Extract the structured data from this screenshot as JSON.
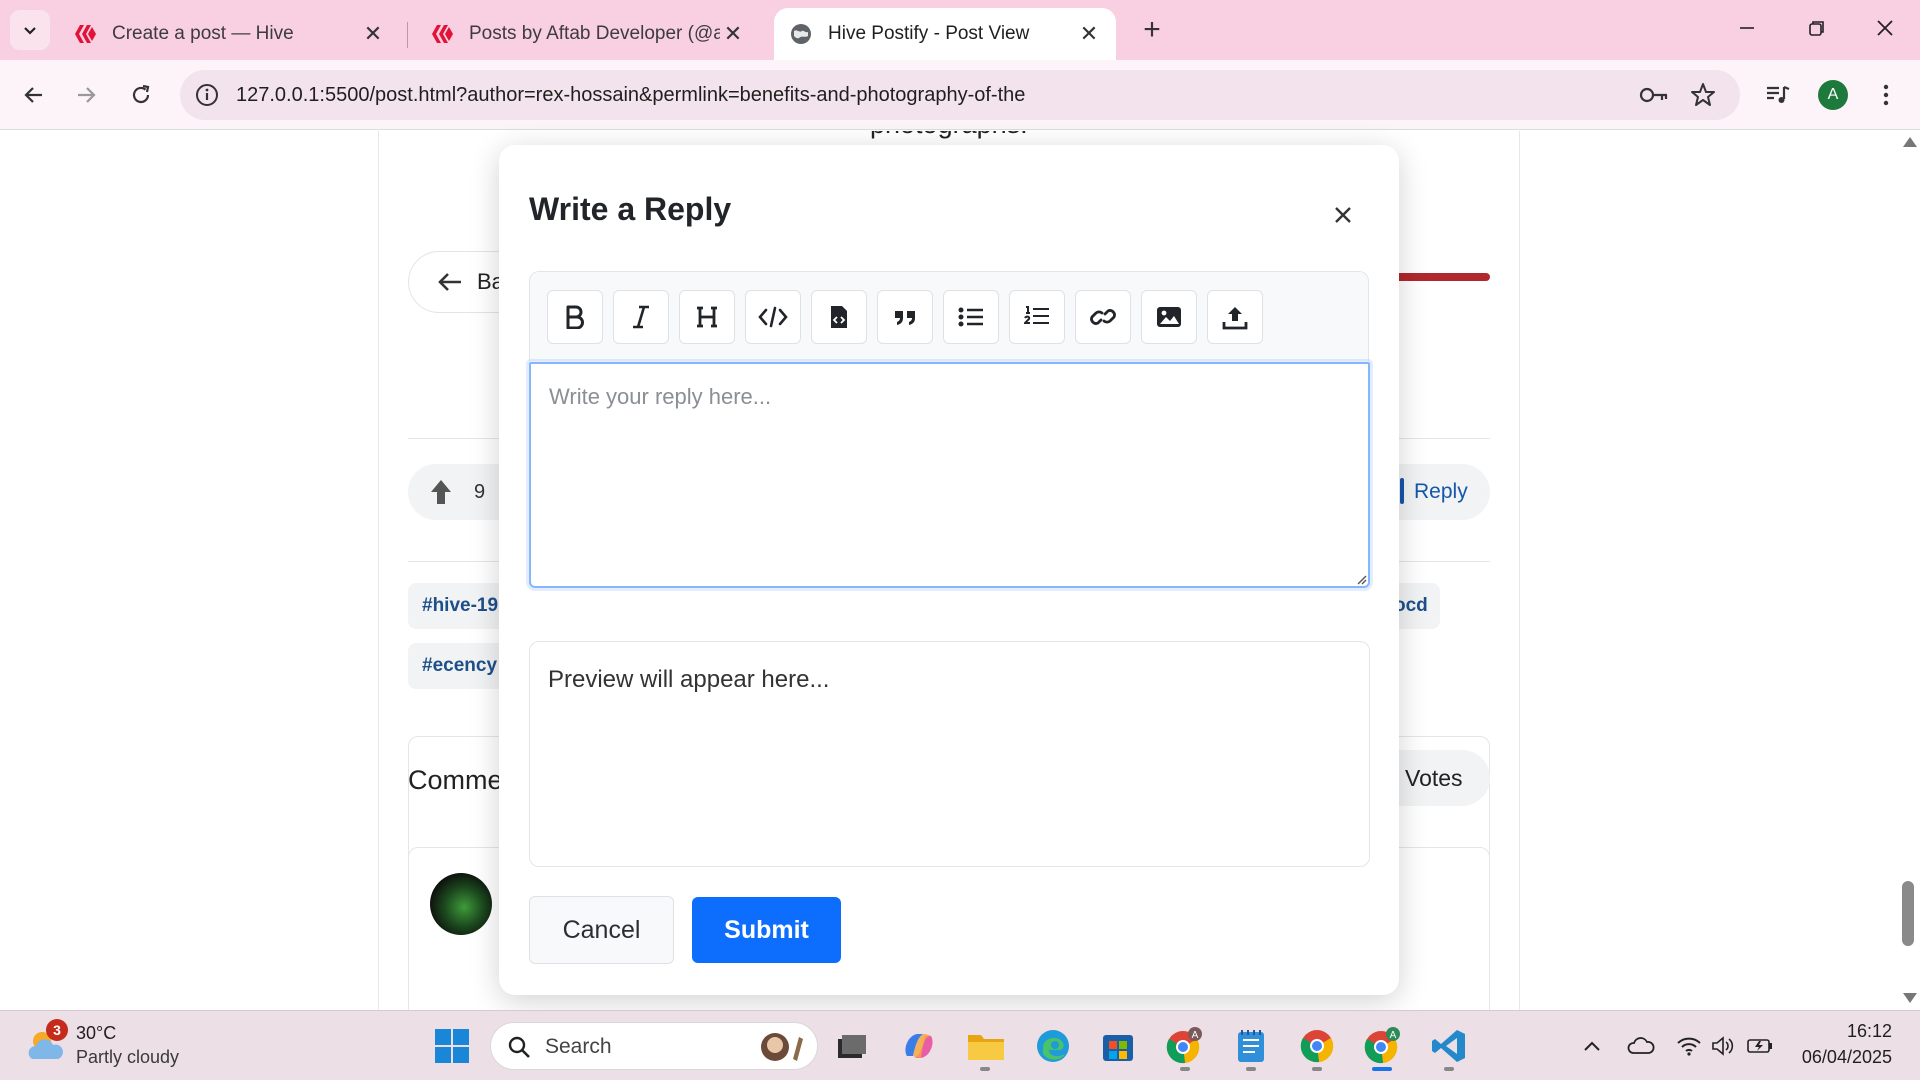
{
  "browser": {
    "tabs": [
      {
        "title": "Create a post — Hive",
        "favicon": "hive-logo-icon",
        "active": false
      },
      {
        "title": "Posts by Aftab Developer (@aftab",
        "favicon": "hive-logo-icon",
        "active": false
      },
      {
        "title": "Hive Postify - Post View",
        "favicon": "globe-icon",
        "active": true
      }
    ],
    "url": "127.0.0.1:5500/post.html?author=rex-hossain&permlink=benefits-and-photography-of-the",
    "profile_initial": "A",
    "accent": "#f9cfe2"
  },
  "page": {
    "partial_text_top": "photographs.",
    "back_label": "Ba",
    "vote_count": "9",
    "reply_label": "Reply",
    "tags": [
      "#hive-19",
      "#ecency",
      "ocd"
    ],
    "comments_heading": "Comme",
    "votes_label": "Votes"
  },
  "modal": {
    "title": "Write a Reply",
    "toolbar": [
      {
        "name": "bold-icon",
        "tooltip": "Bold"
      },
      {
        "name": "italic-icon",
        "tooltip": "Italic"
      },
      {
        "name": "heading-icon",
        "tooltip": "Heading"
      },
      {
        "name": "code-icon",
        "tooltip": "Code"
      },
      {
        "name": "code-file-icon",
        "tooltip": "Code block"
      },
      {
        "name": "quote-icon",
        "tooltip": "Quote"
      },
      {
        "name": "bullet-list-icon",
        "tooltip": "Bullet list"
      },
      {
        "name": "numbered-list-icon",
        "tooltip": "Numbered list"
      },
      {
        "name": "link-icon",
        "tooltip": "Link"
      },
      {
        "name": "image-icon",
        "tooltip": "Image"
      },
      {
        "name": "upload-icon",
        "tooltip": "Upload"
      }
    ],
    "textarea_placeholder": "Write your reply here...",
    "textarea_value": "",
    "preview_text": "Preview will appear here...",
    "cancel_label": "Cancel",
    "submit_label": "Submit",
    "submit_color": "#0d6efd"
  },
  "taskbar": {
    "weather_temp": "30°C",
    "weather_desc": "Partly cloudy",
    "weather_badge": "3",
    "search_label": "Search",
    "time": "16:12",
    "date": "06/04/2025"
  }
}
